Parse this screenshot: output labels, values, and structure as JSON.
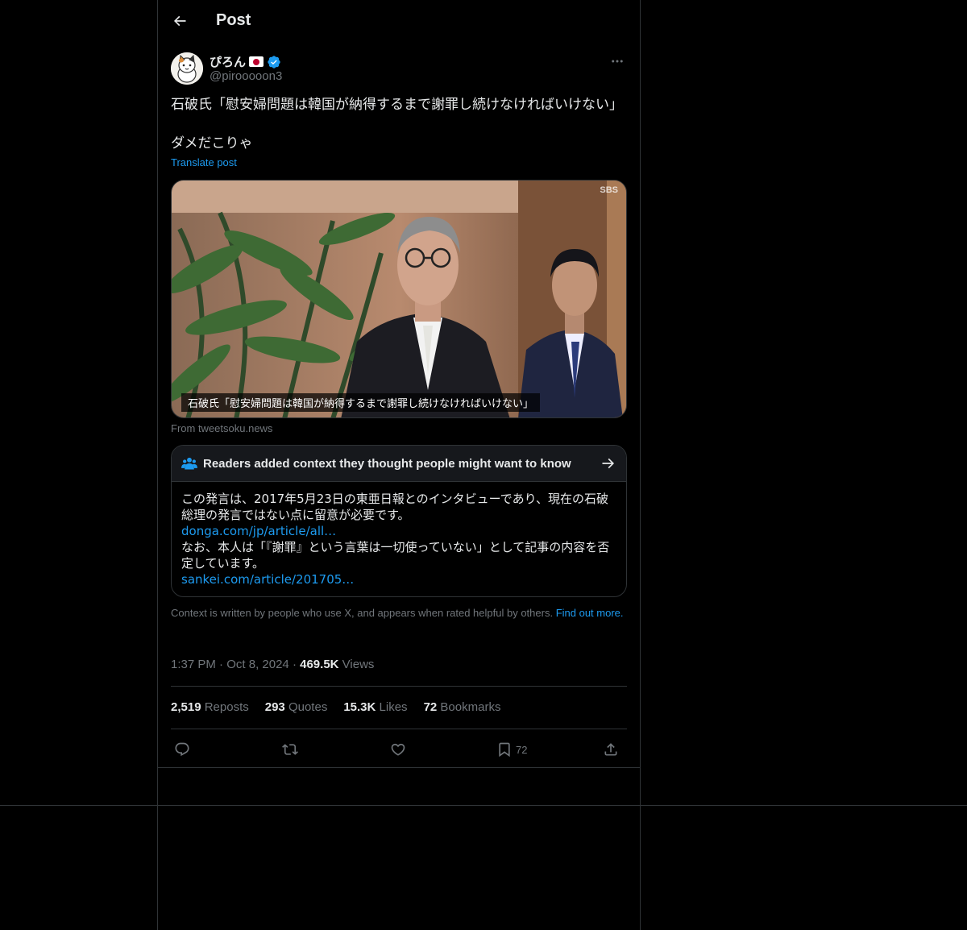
{
  "header": {
    "title": "Post",
    "back_icon": "arrow-left-icon"
  },
  "author": {
    "display_name": "ぴろん",
    "handle": "@pirooooon3",
    "flag_icon": "japan-flag-icon",
    "verified_icon": "verified-badge-icon",
    "verified_color": "#1d9bf0"
  },
  "post": {
    "text": "石破氏「慰安婦問題は韓国が納得するまで謝罪し続けなければいけない」\n\nダメだこりゃ",
    "translate_label": "Translate post"
  },
  "media": {
    "caption": "石破氏「慰安婦問題は韓国が納得するまで謝罪し続けなければいけない」",
    "watermark": "SBS",
    "source": "From tweetsoku.news"
  },
  "community_note": {
    "title": "Readers added context they thought people might want to know",
    "line1": "この発言は、2017年5月23日の東亜日報とのインタビューであり、現在の石破総理の発言ではない点に留意が必要です。",
    "link1": "donga.com/jp/article/all…",
    "line2": "なお、本人は「『謝罪』という言葉は一切使っていない」として記事の内容を否定しています。",
    "link2": "sankei.com/article/201705…",
    "footer": "Context is written by people who use X, and appears when rated helpful by others.",
    "footer_link": "Find out more."
  },
  "meta": {
    "time": "1:37 PM",
    "date": "Oct 8, 2024",
    "views_count": "469.5K",
    "views_label": "Views"
  },
  "stats": {
    "reposts_count": "2,519",
    "reposts_label": "Reposts",
    "quotes_count": "293",
    "quotes_label": "Quotes",
    "likes_count": "15.3K",
    "likes_label": "Likes",
    "bookmarks_count": "72",
    "bookmarks_label": "Bookmarks"
  },
  "actions": {
    "bookmark_count": "72"
  },
  "colors": {
    "background": "#000000",
    "text": "#e7e9ea",
    "muted": "#71767b",
    "accent": "#1d9bf0",
    "border": "#2f3336"
  }
}
